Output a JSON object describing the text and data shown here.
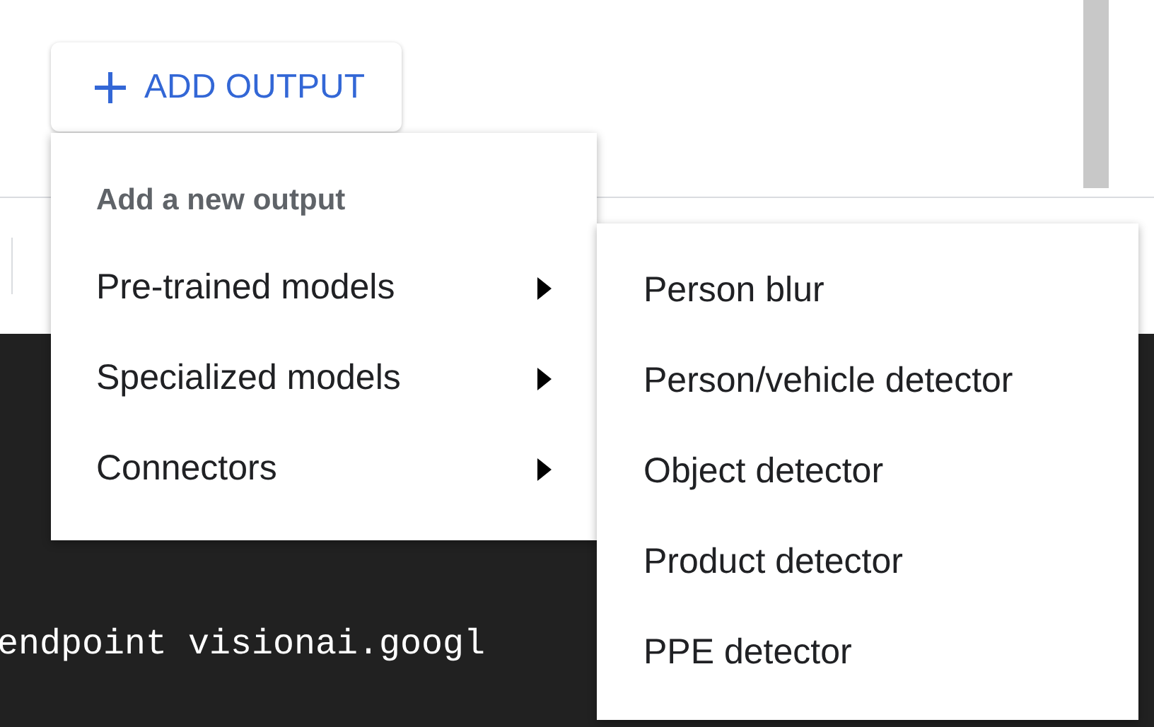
{
  "add_button": {
    "label": "ADD OUTPUT"
  },
  "menu": {
    "header": "Add a new output",
    "items": [
      {
        "label": "Pre-trained models"
      },
      {
        "label": "Specialized models"
      },
      {
        "label": "Connectors"
      }
    ]
  },
  "submenu": {
    "items": [
      {
        "label": "Person blur"
      },
      {
        "label": "Person/vehicle detector"
      },
      {
        "label": "Object detector"
      },
      {
        "label": "Product detector"
      },
      {
        "label": "PPE detector"
      }
    ]
  },
  "terminal": {
    "text": "endpoint visionai.googl"
  }
}
